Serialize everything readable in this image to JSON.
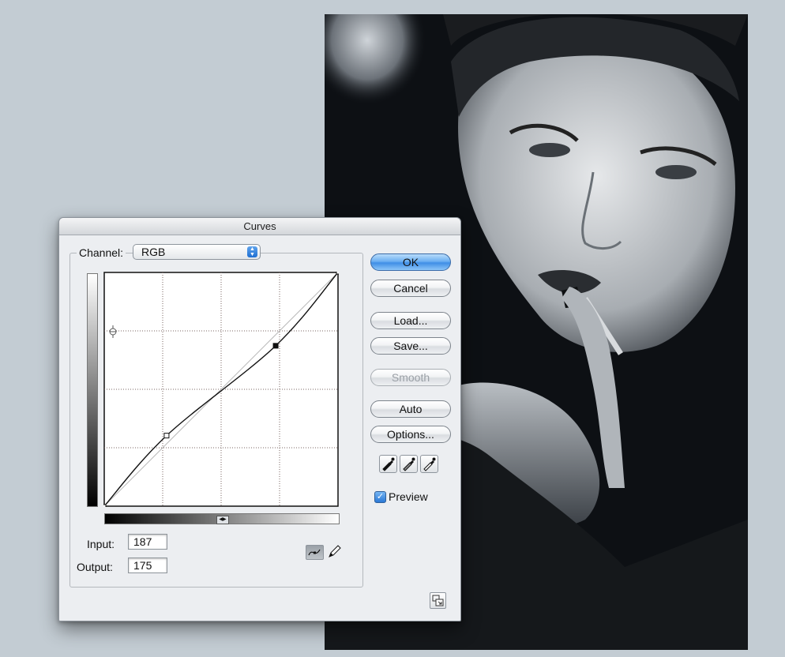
{
  "dialog": {
    "title": "Curves",
    "channel": {
      "label": "Channel:",
      "value": "RGB"
    },
    "input": {
      "label": "Input:",
      "value": "187"
    },
    "output": {
      "label": "Output:",
      "value": "175"
    },
    "buttons": {
      "ok": "OK",
      "cancel": "Cancel",
      "load": "Load...",
      "save": "Save...",
      "smooth": "Smooth",
      "auto": "Auto",
      "options": "Options..."
    },
    "preview": {
      "label": "Preview",
      "checked": true
    },
    "smooth_enabled": false,
    "curve_tool_selected": "point-curve"
  },
  "curve_points": [
    {
      "input": 0,
      "output": 0
    },
    {
      "input": 68,
      "output": 77
    },
    {
      "input": 187,
      "output": 175
    },
    {
      "input": 255,
      "output": 255
    }
  ],
  "colors": {
    "desktop_bg": "#c3ccd3",
    "dialog_bg": "#eceef1",
    "default_button": "#4a97ea",
    "photo_bg": "#0d1014"
  },
  "icons": {
    "channel_dropdown": "up-down-arrows-icon",
    "point_tool": "curve-point-icon",
    "pencil_tool": "pencil-icon",
    "black_point": "black-eyedropper-icon",
    "gray_point": "gray-eyedropper-icon",
    "white_point": "white-eyedropper-icon",
    "expand": "expand-dialog-icon"
  }
}
